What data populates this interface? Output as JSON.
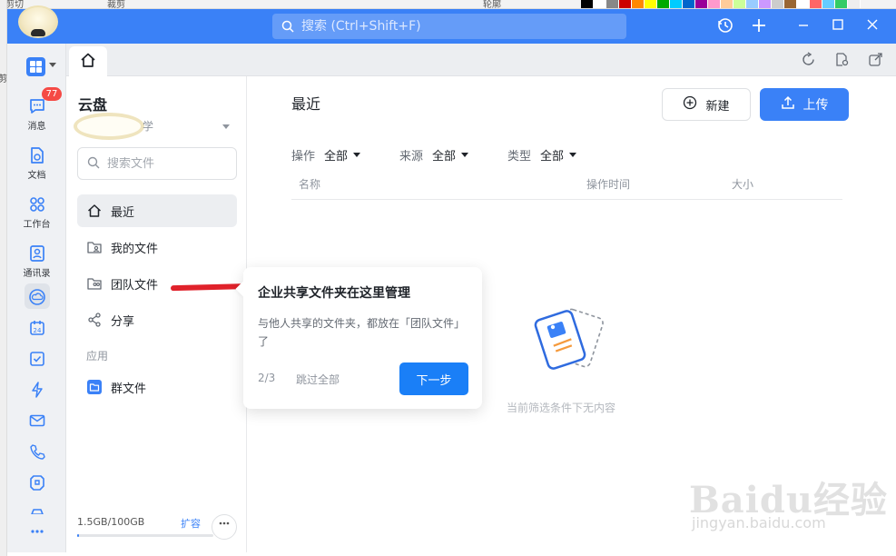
{
  "background_app": {
    "toolbar_fragments": [
      "剪切",
      "裁剪",
      "轮廓"
    ],
    "left_fragment": "剪"
  },
  "titlebar": {
    "search_placeholder": "搜索 (Ctrl+Shift+F)",
    "icons": [
      "history-icon",
      "plus-icon",
      "minimize-icon",
      "maximize-icon",
      "close-icon"
    ]
  },
  "tabs": {
    "home_icon": "home-icon",
    "right_icons": [
      "refresh-icon",
      "file-search-icon",
      "share-window-icon"
    ]
  },
  "rail": {
    "badge": "77",
    "items": [
      {
        "label": "消息",
        "icon": "message-icon"
      },
      {
        "label": "文档",
        "icon": "document-icon"
      },
      {
        "label": "工作台",
        "icon": "workbench-icon"
      },
      {
        "label": "通讯录",
        "icon": "contacts-icon"
      }
    ],
    "icon_only": [
      "cloud-icon",
      "calendar-icon",
      "todo-icon",
      "lightning-icon",
      "mail-icon",
      "phone-icon",
      "doc-sync-icon",
      "car-icon",
      "more-icon"
    ],
    "calendar_day": "24"
  },
  "panel": {
    "title": "云盘",
    "org_suffix": "学",
    "search_placeholder": "搜索文件",
    "nav": [
      {
        "label": "最近",
        "icon": "home-icon"
      },
      {
        "label": "我的文件",
        "icon": "user-folder-icon"
      },
      {
        "label": "团队文件",
        "icon": "team-folder-icon"
      },
      {
        "label": "分享",
        "icon": "share-icon"
      }
    ],
    "section_apps": "应用",
    "group_files": "群文件",
    "storage": "1.5GB/100GB",
    "storage_ratio": 0.015,
    "expand": "扩容"
  },
  "main": {
    "title": "最近",
    "new_button": "新建",
    "upload_button": "上传",
    "filters": [
      {
        "label": "操作",
        "value": "全部"
      },
      {
        "label": "来源",
        "value": "全部"
      },
      {
        "label": "类型",
        "value": "全部"
      }
    ],
    "columns": [
      "名称",
      "操作时间",
      "大小"
    ],
    "empty_text": "当前筛选条件下无内容"
  },
  "popover": {
    "title": "企业共享文件夹在这里管理",
    "body": "与他人共享的文件夹，都放在「团队文件」了",
    "step": "2/3",
    "skip": "跳过全部",
    "next": "下一步"
  },
  "watermark": {
    "logo": "Baidu经验",
    "url": "jingyan.baidu.com"
  },
  "colors": {
    "accent": "#3a81f7",
    "badge": "#f54a45",
    "annotation": "#e0222b"
  }
}
